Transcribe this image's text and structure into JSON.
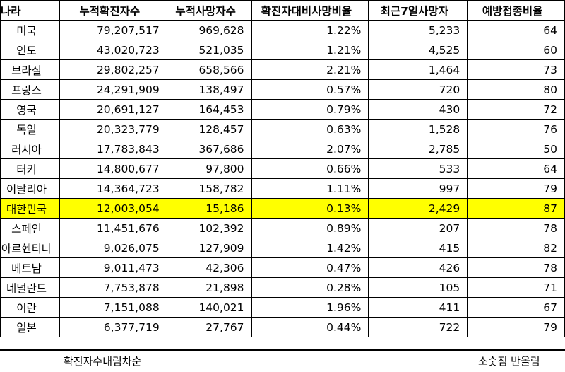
{
  "columns": [
    "나라",
    "누적확진자수",
    "누적사망자수",
    "확진자대비사망비율",
    "최근7일사망자",
    "예방접종비율"
  ],
  "rows": [
    {
      "country": "미국",
      "cases": "79,207,517",
      "deaths": "969,628",
      "rate": "1.22%",
      "recent": "5,233",
      "vax": "64"
    },
    {
      "country": "인도",
      "cases": "43,020,723",
      "deaths": "521,035",
      "rate": "1.21%",
      "recent": "4,525",
      "vax": "60"
    },
    {
      "country": "브라질",
      "cases": "29,802,257",
      "deaths": "658,566",
      "rate": "2.21%",
      "recent": "1,464",
      "vax": "73"
    },
    {
      "country": "프랑스",
      "cases": "24,291,909",
      "deaths": "138,497",
      "rate": "0.57%",
      "recent": "720",
      "vax": "80"
    },
    {
      "country": "영국",
      "cases": "20,691,127",
      "deaths": "164,453",
      "rate": "0.79%",
      "recent": "430",
      "vax": "72"
    },
    {
      "country": "독일",
      "cases": "20,323,779",
      "deaths": "128,457",
      "rate": "0.63%",
      "recent": "1,528",
      "vax": "76"
    },
    {
      "country": "러시아",
      "cases": "17,783,843",
      "deaths": "367,686",
      "rate": "2.07%",
      "recent": "2,785",
      "vax": "50"
    },
    {
      "country": "터키",
      "cases": "14,800,677",
      "deaths": "97,800",
      "rate": "0.66%",
      "recent": "533",
      "vax": "64"
    },
    {
      "country": "이탈리아",
      "cases": "14,364,723",
      "deaths": "158,782",
      "rate": "1.11%",
      "recent": "997",
      "vax": "79"
    },
    {
      "country": "대한민국",
      "cases": "12,003,054",
      "deaths": "15,186",
      "rate": "0.13%",
      "recent": "2,429",
      "vax": "87"
    },
    {
      "country": "스페인",
      "cases": "11,451,676",
      "deaths": "102,392",
      "rate": "0.89%",
      "recent": "207",
      "vax": "78"
    },
    {
      "country": "아르헨티나",
      "cases": "9,026,075",
      "deaths": "127,909",
      "rate": "1.42%",
      "recent": "415",
      "vax": "82"
    },
    {
      "country": "베트남",
      "cases": "9,011,473",
      "deaths": "42,306",
      "rate": "0.47%",
      "recent": "426",
      "vax": "78"
    },
    {
      "country": "네덜란드",
      "cases": "7,753,878",
      "deaths": "21,898",
      "rate": "0.28%",
      "recent": "105",
      "vax": "71"
    },
    {
      "country": "이란",
      "cases": "7,151,088",
      "deaths": "140,021",
      "rate": "1.96%",
      "recent": "411",
      "vax": "67"
    },
    {
      "country": "일본",
      "cases": "6,377,719",
      "deaths": "27,767",
      "rate": "0.44%",
      "recent": "722",
      "vax": "79"
    }
  ],
  "highlight_color": "#ffff00",
  "footer": {
    "left_note": "확진자수내림차순",
    "right_note": "소숫점 반올림"
  }
}
